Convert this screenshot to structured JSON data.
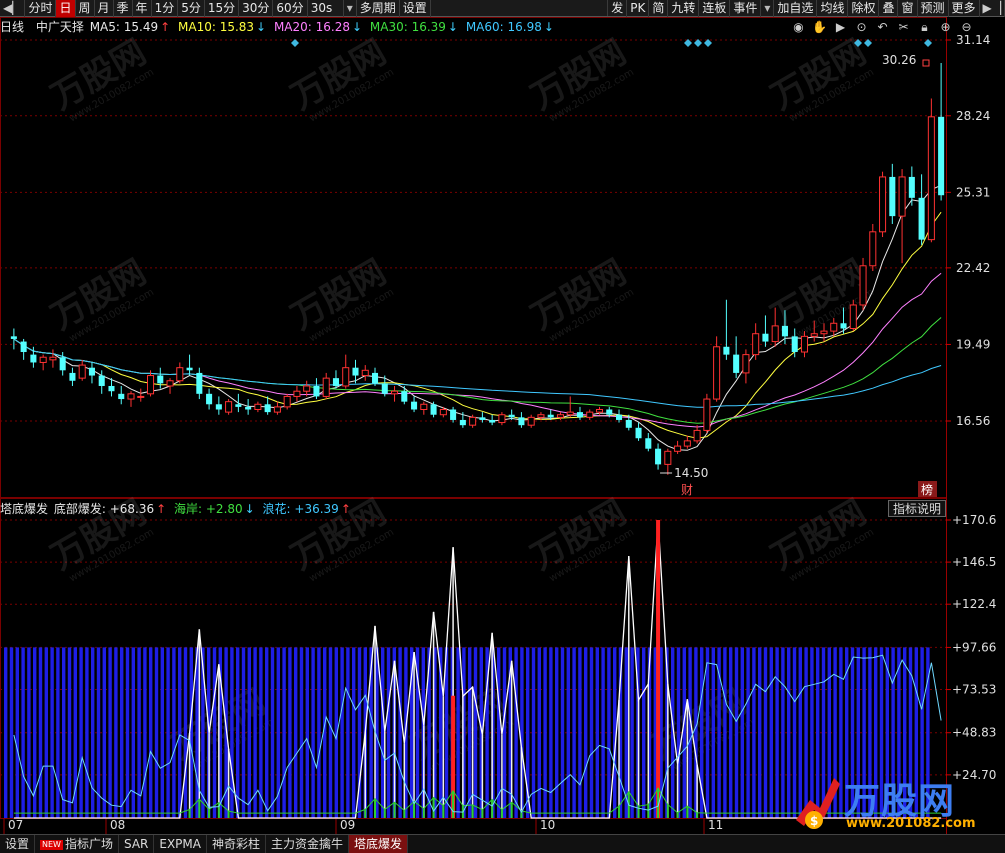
{
  "toolbar": {
    "items": [
      "分时",
      "日",
      "周",
      "月",
      "季",
      "年",
      "1分",
      "5分",
      "15分",
      "30分",
      "60分",
      "30s",
      "多周期",
      "设置"
    ],
    "active_index": 1,
    "right_items": [
      "发",
      "PK",
      "简",
      "九转",
      "连板",
      "事件",
      "加自选",
      "均线",
      "除权",
      "叠",
      "窗",
      "预测",
      "更多"
    ]
  },
  "ma_strip": {
    "period": "日线",
    "stock": "中广天择",
    "ma": [
      {
        "label": "MA5: 15.49",
        "arrow": "↑",
        "color": "#e8e8e8",
        "arrow_color": "#ff4040"
      },
      {
        "label": "MA10: 15.83",
        "arrow": "↓",
        "color": "#ffff40",
        "arrow_color": "#40d0ff"
      },
      {
        "label": "MA20: 16.28",
        "arrow": "↓",
        "color": "#ff80ff",
        "arrow_color": "#40d0ff"
      },
      {
        "label": "MA30: 16.39",
        "arrow": "↓",
        "color": "#40e040",
        "arrow_color": "#40d0ff"
      },
      {
        "label": "MA60: 16.98",
        "arrow": "↓",
        "color": "#40c8ff",
        "arrow_color": "#40d0ff"
      }
    ]
  },
  "price_axis": {
    "labels": [
      "31.14",
      "28.24",
      "25.31",
      "22.42",
      "19.49",
      "16.56"
    ]
  },
  "price_annotations": {
    "high_label": "30.26",
    "low_label": "14.50",
    "fin_marker": "财",
    "bang_marker": "榜"
  },
  "indicator": {
    "title": "塔底爆发",
    "items": [
      {
        "label": "底部爆发: +68.36",
        "arrow": "↑",
        "color": "#e8e8e8",
        "arrow_color": "#ff4040"
      },
      {
        "label": "海岸: +2.80",
        "arrow": "↓",
        "color": "#40e040",
        "arrow_color": "#40d0ff"
      },
      {
        "label": "浪花: +36.39",
        "arrow": "↑",
        "color": "#40c8ff",
        "arrow_color": "#ff4040"
      }
    ],
    "help_label": "指标说明",
    "axis_labels": [
      "170.6",
      "146.5",
      "122.4",
      "97.66",
      "73.53",
      "48.83",
      "24.70"
    ]
  },
  "x_axis": {
    "labels": [
      "07",
      "08",
      "09",
      "10",
      "11"
    ]
  },
  "bottom_tabs": {
    "items": [
      "设置",
      "指标广场",
      "SAR",
      "EXPMA",
      "神奇彩柱",
      "主力资金擒牛",
      "塔底爆发"
    ],
    "new_badge": "NEW",
    "active_index": 6
  },
  "watermark": {
    "brand": "万股网",
    "url": "www.2010082.com"
  },
  "logo": {
    "brand": "万股网",
    "url": "www.201082.com"
  },
  "chart_data": {
    "type": "candlestick",
    "ylim": [
      14.0,
      31.14
    ],
    "price_ticks": [
      31.14,
      28.24,
      25.31,
      22.42,
      19.49,
      16.56
    ],
    "x_labels": [
      "07",
      "08",
      "09",
      "10",
      "11"
    ],
    "candles": [
      [
        19.8,
        20.1,
        19.3,
        19.7
      ],
      [
        19.6,
        19.7,
        18.9,
        19.2
      ],
      [
        19.1,
        19.4,
        18.6,
        18.8
      ],
      [
        18.8,
        19.1,
        18.5,
        19.0
      ],
      [
        18.9,
        19.3,
        18.6,
        19.0
      ],
      [
        19.0,
        19.2,
        18.3,
        18.5
      ],
      [
        18.4,
        18.6,
        17.9,
        18.1
      ],
      [
        18.2,
        18.9,
        18.1,
        18.7
      ],
      [
        18.6,
        18.8,
        18.0,
        18.3
      ],
      [
        18.3,
        18.5,
        17.6,
        17.9
      ],
      [
        17.9,
        18.2,
        17.5,
        17.7
      ],
      [
        17.6,
        17.9,
        17.2,
        17.4
      ],
      [
        17.4,
        17.7,
        17.1,
        17.6
      ],
      [
        17.5,
        17.8,
        17.3,
        17.5
      ],
      [
        17.6,
        18.5,
        17.5,
        18.3
      ],
      [
        18.3,
        18.6,
        17.8,
        18.0
      ],
      [
        17.9,
        18.2,
        17.6,
        18.1
      ],
      [
        18.1,
        18.8,
        18.0,
        18.6
      ],
      [
        18.6,
        19.1,
        18.3,
        18.5
      ],
      [
        18.4,
        18.6,
        17.4,
        17.6
      ],
      [
        17.6,
        17.8,
        17.0,
        17.2
      ],
      [
        17.2,
        17.5,
        16.8,
        17.0
      ],
      [
        16.9,
        17.4,
        16.8,
        17.3
      ],
      [
        17.2,
        17.6,
        16.9,
        17.1
      ],
      [
        17.1,
        17.4,
        16.8,
        17.0
      ],
      [
        17.0,
        17.3,
        16.9,
        17.2
      ],
      [
        17.2,
        17.5,
        16.8,
        16.9
      ],
      [
        16.9,
        17.3,
        16.8,
        17.1
      ],
      [
        17.1,
        17.6,
        17.0,
        17.5
      ],
      [
        17.5,
        17.9,
        17.3,
        17.7
      ],
      [
        17.7,
        18.1,
        17.5,
        17.9
      ],
      [
        17.9,
        18.2,
        17.4,
        17.5
      ],
      [
        17.5,
        18.4,
        17.4,
        18.2
      ],
      [
        18.2,
        18.5,
        17.8,
        17.9
      ],
      [
        17.9,
        19.1,
        17.8,
        18.6
      ],
      [
        18.6,
        18.9,
        18.0,
        18.3
      ],
      [
        18.3,
        18.7,
        18.1,
        18.5
      ],
      [
        18.4,
        18.6,
        17.9,
        18.0
      ],
      [
        18.0,
        18.3,
        17.5,
        17.6
      ],
      [
        17.6,
        17.9,
        17.3,
        17.7
      ],
      [
        17.7,
        17.9,
        17.2,
        17.3
      ],
      [
        17.3,
        17.5,
        16.9,
        17.0
      ],
      [
        17.0,
        17.3,
        16.8,
        17.2
      ],
      [
        17.2,
        17.3,
        16.7,
        16.8
      ],
      [
        16.8,
        17.1,
        16.7,
        17.0
      ],
      [
        17.0,
        17.1,
        16.5,
        16.6
      ],
      [
        16.6,
        16.9,
        16.3,
        16.4
      ],
      [
        16.4,
        16.8,
        16.3,
        16.7
      ],
      [
        16.7,
        16.9,
        16.5,
        16.6
      ],
      [
        16.6,
        16.8,
        16.4,
        16.5
      ],
      [
        16.5,
        16.9,
        16.4,
        16.8
      ],
      [
        16.8,
        17.0,
        16.6,
        16.7
      ],
      [
        16.7,
        16.9,
        16.3,
        16.4
      ],
      [
        16.4,
        16.8,
        16.3,
        16.7
      ],
      [
        16.7,
        16.9,
        16.6,
        16.8
      ],
      [
        16.8,
        17.0,
        16.6,
        16.7
      ],
      [
        16.7,
        16.9,
        16.6,
        16.8
      ],
      [
        16.8,
        17.5,
        16.7,
        16.9
      ],
      [
        16.9,
        17.1,
        16.6,
        16.7
      ],
      [
        16.7,
        17.0,
        16.6,
        16.9
      ],
      [
        16.9,
        17.1,
        16.8,
        17.0
      ],
      [
        17.0,
        17.1,
        16.7,
        16.8
      ],
      [
        16.8,
        17.0,
        16.5,
        16.6
      ],
      [
        16.6,
        16.8,
        16.2,
        16.3
      ],
      [
        16.3,
        16.5,
        15.8,
        15.9
      ],
      [
        15.9,
        16.1,
        15.4,
        15.5
      ],
      [
        15.5,
        15.7,
        14.7,
        14.9
      ],
      [
        14.9,
        15.5,
        14.5,
        15.4
      ],
      [
        15.4,
        15.8,
        15.3,
        15.6
      ],
      [
        15.6,
        16.0,
        15.5,
        15.8
      ],
      [
        15.8,
        16.4,
        15.7,
        16.2
      ],
      [
        16.2,
        17.6,
        16.1,
        17.4
      ],
      [
        17.4,
        19.8,
        17.3,
        19.4
      ],
      [
        19.4,
        21.2,
        18.9,
        19.1
      ],
      [
        19.1,
        19.8,
        18.2,
        18.4
      ],
      [
        18.4,
        19.3,
        18.0,
        19.1
      ],
      [
        19.1,
        20.3,
        18.9,
        19.9
      ],
      [
        19.9,
        20.6,
        19.4,
        19.6
      ],
      [
        19.6,
        20.9,
        19.4,
        20.2
      ],
      [
        20.2,
        20.8,
        19.5,
        19.8
      ],
      [
        19.8,
        20.1,
        19.0,
        19.2
      ],
      [
        19.2,
        20.0,
        19.0,
        19.8
      ],
      [
        19.8,
        20.4,
        19.6,
        19.9
      ],
      [
        19.9,
        20.3,
        19.6,
        20.0
      ],
      [
        20.0,
        20.5,
        19.8,
        20.3
      ],
      [
        20.3,
        20.9,
        19.9,
        20.1
      ],
      [
        20.1,
        21.2,
        20.0,
        21.0
      ],
      [
        21.0,
        22.8,
        20.8,
        22.5
      ],
      [
        22.5,
        24.1,
        22.3,
        23.8
      ],
      [
        23.8,
        26.1,
        23.6,
        25.9
      ],
      [
        25.9,
        26.4,
        24.1,
        24.4
      ],
      [
        24.4,
        26.2,
        22.6,
        25.9
      ],
      [
        25.9,
        26.3,
        24.8,
        25.1
      ],
      [
        25.1,
        26.0,
        23.3,
        23.5
      ],
      [
        23.5,
        28.9,
        23.4,
        28.2
      ],
      [
        28.2,
        30.26,
        25.0,
        25.2
      ]
    ],
    "ma_lines": [
      {
        "name": "MA5",
        "color": "#e8e8e8",
        "first": 19.7,
        "last": 26.6
      },
      {
        "name": "MA10",
        "color": "#ffff40",
        "first": 19.6,
        "last": 25.3
      },
      {
        "name": "MA20",
        "color": "#ff80ff",
        "first": 19.3,
        "last": 22.6
      },
      {
        "name": "MA30",
        "color": "#40e040",
        "first": 19.0,
        "last": 20.8
      },
      {
        "name": "MA60",
        "color": "#40c8ff",
        "first": 18.8,
        "last": 18.6
      }
    ],
    "indicator": {
      "ylim": [
        0,
        175
      ],
      "ticks": [
        170.6,
        146.5,
        122.4,
        97.66,
        73.53,
        48.83,
        24.7
      ],
      "bars": 97.66,
      "spikes": [
        {
          "i": 19,
          "v": 108
        },
        {
          "i": 21,
          "v": 88
        },
        {
          "i": 37,
          "v": 110
        },
        {
          "i": 39,
          "v": 90
        },
        {
          "i": 41,
          "v": 95
        },
        {
          "i": 43,
          "v": 118
        },
        {
          "i": 45,
          "v": 155
        },
        {
          "i": 47,
          "v": 75
        },
        {
          "i": 49,
          "v": 106
        },
        {
          "i": 51,
          "v": 90
        },
        {
          "i": 63,
          "v": 150
        },
        {
          "i": 66,
          "v": 170.6
        },
        {
          "i": 69,
          "v": 68
        }
      ],
      "red_bars": [
        {
          "i": 45,
          "v": 70
        },
        {
          "i": 66,
          "v": 170.6
        }
      ],
      "wave_end": 90,
      "coast_level": 2.8
    }
  }
}
